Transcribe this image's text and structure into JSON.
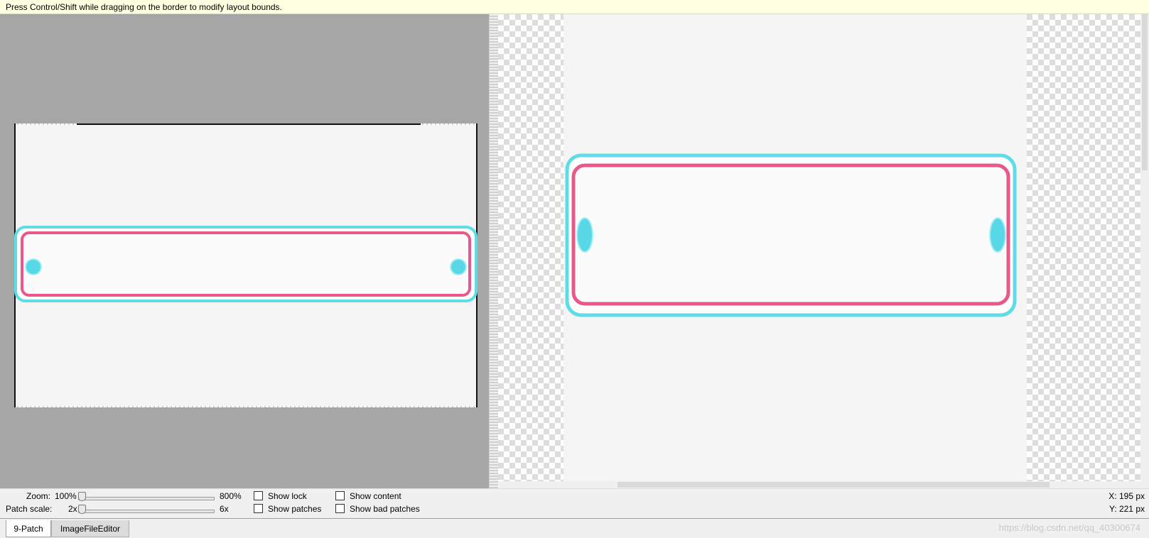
{
  "hint": "Press Control/Shift while dragging on the border to modify layout bounds.",
  "controls": {
    "zoom_label": "Zoom:",
    "zoom_min": "100%",
    "zoom_max": "800%",
    "zoom_value": 0.0,
    "patch_scale_label": "Patch scale:",
    "patch_min": "2x",
    "patch_max": "6x",
    "patch_value": 0.0,
    "show_lock": "Show lock",
    "show_content": "Show content",
    "show_patches": "Show patches",
    "show_bad_patches": "Show bad patches",
    "x_readout": "X: 195 px",
    "y_readout": "Y: 221 px"
  },
  "tabs": [
    {
      "label": "9-Patch",
      "active": true
    },
    {
      "label": "ImageFileEditor",
      "active": false
    }
  ],
  "watermark": "https://blog.csdn.net/qq_40300674",
  "colors": {
    "cyan_frame": "#5fdde6",
    "pink_frame": "#e8588a",
    "editor_bg": "#a6a6a6",
    "hint_bg": "#ffffe1"
  },
  "icons": [
    "slider-thumb-icon",
    "checkbox-icon"
  ]
}
